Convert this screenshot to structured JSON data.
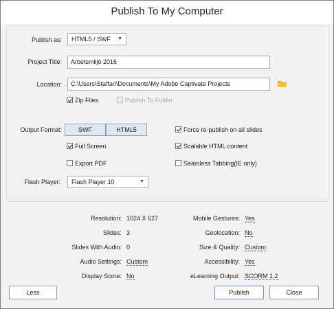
{
  "dialog": {
    "title": "Publish To My Computer"
  },
  "publish_as": {
    "label": "Publish as:",
    "value": "HTML5 / SWF"
  },
  "project_title": {
    "label": "Project Title:",
    "value": "Arbetsmiljö 2016"
  },
  "location": {
    "label": "Location:",
    "value": "C:\\Users\\Staffan\\Documents\\My Adobe Captivate Projects"
  },
  "zip_files": {
    "label": "Zip Files",
    "checked": true
  },
  "publish_to_folder": {
    "label": "Publish To Folder",
    "checked": false,
    "disabled": true
  },
  "output_format": {
    "label": "Output Format:",
    "options": [
      "SWF",
      "HTML5"
    ]
  },
  "full_screen": {
    "label": "Full Screen",
    "checked": true
  },
  "export_pdf": {
    "label": "Export PDF",
    "checked": false
  },
  "force_republish": {
    "label": "Force re-publish on all slides",
    "checked": true
  },
  "scalable_html": {
    "label": "Scalable HTML content",
    "checked": true
  },
  "seamless_tabbing": {
    "label": "Seamless Tabbing(IE only)",
    "checked": false
  },
  "flash_player": {
    "label": "Flash Player:",
    "value": "Flash Player 10"
  },
  "summary": {
    "resolution": {
      "label": "Resolution:",
      "value": "1024 X 627"
    },
    "slides": {
      "label": "Slides:",
      "value": "3"
    },
    "slides_with_audio": {
      "label": "Slides With Audio:",
      "value": "0"
    },
    "audio_settings": {
      "label": "Audio Settings:",
      "value": "Custom"
    },
    "display_score": {
      "label": "Display Score:",
      "value": "No"
    },
    "mobile_gestures": {
      "label": "Mobile Gestures:",
      "value": "Yes"
    },
    "geolocation": {
      "label": "Geolocation:",
      "value": "No"
    },
    "size_quality": {
      "label": "Size & Quality:",
      "value": "Custom"
    },
    "accessibility": {
      "label": "Accessibility:",
      "value": "Yes"
    },
    "elearning_output": {
      "label": "eLearning Output:",
      "value": "SCORM 1.2"
    }
  },
  "buttons": {
    "less": "Less",
    "publish": "Publish",
    "close": "Close"
  },
  "colors": {
    "link": "#2d6fb4",
    "folder": "#e0b020",
    "segment_active": "#dfe8f1"
  },
  "icons": {
    "browse": "folder-icon",
    "dropdown": "chevron-down-icon"
  }
}
